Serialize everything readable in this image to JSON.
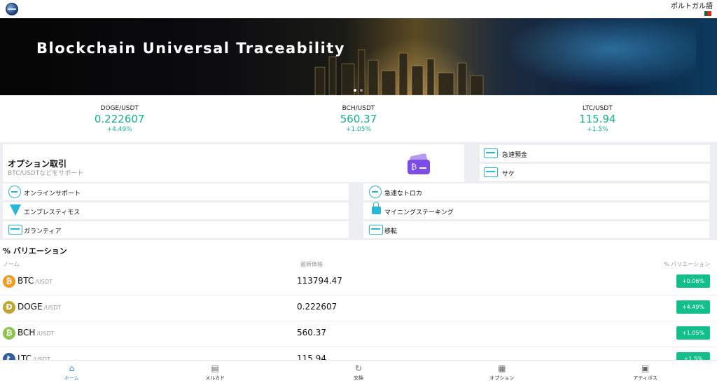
{
  "header": {
    "language": "ポルトガル語"
  },
  "banner": {
    "title": "Blockchain Universal Traceability",
    "slide_count": 2,
    "active_slide": 0
  },
  "ticker": [
    {
      "pair": "DOGE/USDT",
      "price": "0.222607",
      "change": "+4.49%"
    },
    {
      "pair": "BCH/USDT",
      "price": "560.37",
      "change": "+1.05%"
    },
    {
      "pair": "LTC/USDT",
      "price": "115.94",
      "change": "+1.5%"
    }
  ],
  "features": {
    "option": {
      "title": "オプション取引",
      "subtitle": "BTC/USDTなどをサポート"
    },
    "quick_deposit": "急速預金",
    "withdraw": "サケ",
    "online_support": "オンラインサポート",
    "quick_trade": "急速なトロカ",
    "employee_system": "エンプレスティモス",
    "mining_staking": "マイニングステーキング",
    "guarantee": "ガランティア",
    "transfer": "移転"
  },
  "variation": {
    "title": "% バリエーション",
    "columns": {
      "name": "ノーム",
      "price": "最新価格",
      "change": "% バリエーション"
    },
    "rows": [
      {
        "symbol": "BTC",
        "quote": "/USDT",
        "price": "113794.47",
        "change": "+0.06%",
        "color": "#f29a1f",
        "glyph": "₿"
      },
      {
        "symbol": "DOGE",
        "quote": "/USDT",
        "price": "0.222607",
        "change": "+4.49%",
        "color": "#c2a633",
        "glyph": "Ð"
      },
      {
        "symbol": "BCH",
        "quote": "/USDT",
        "price": "560.37",
        "change": "+1.05%",
        "color": "#8dc351",
        "glyph": "₿"
      },
      {
        "symbol": "LTC",
        "quote": "/USDT",
        "price": "115.94",
        "change": "+1.5%",
        "color": "#345d9d",
        "glyph": "Ł"
      }
    ]
  },
  "nav": {
    "home": "ホーム",
    "market": "メルカド",
    "exchange": "交換",
    "options": "オプション",
    "assets": "アティボス"
  },
  "colors": {
    "up": "#12bf8b",
    "accent": "#2c86d8",
    "icon": "#28b7d6"
  }
}
